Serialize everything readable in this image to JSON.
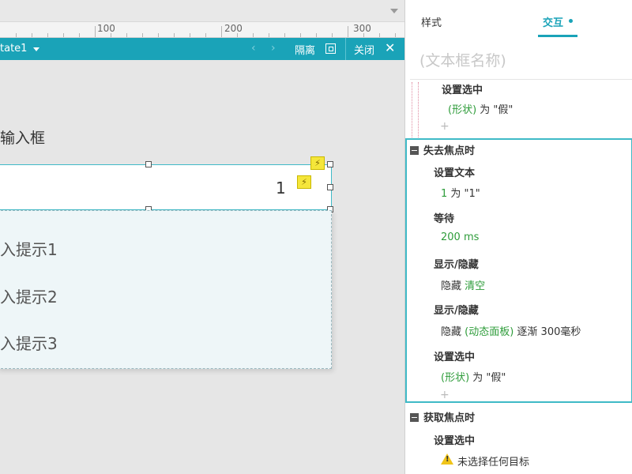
{
  "ruler": {
    "labels": [
      "100",
      "200",
      "300"
    ]
  },
  "state_bar": {
    "state_name": "tate1",
    "prev_arrow": "‹",
    "next_arrow": "›",
    "isolate_label": "隔离",
    "close_label": "关闭",
    "close_glyph": "✕",
    "color": "#1aa3b8"
  },
  "canvas": {
    "field_label": "输入框",
    "input_value": "1",
    "hints": [
      "入提示1",
      "入提示2",
      "入提示3"
    ],
    "bolt_glyph": "⚡"
  },
  "panel": {
    "tabs": {
      "style": "样式",
      "interaction": "交互"
    },
    "name_placeholder": "(文本框名称)",
    "top_action": {
      "title": "设置选中",
      "target": "(形状)",
      "rest": " 为 \"假\""
    },
    "plus": "+",
    "blur_event": {
      "title": "失去焦点时",
      "actions": [
        {
          "title": "设置文本",
          "target": "1",
          "rest": " 为 \"1\""
        },
        {
          "title": "等待",
          "target": "200 ms",
          "rest": ""
        },
        {
          "title": "显示/隐藏",
          "prefix": "隐藏 ",
          "target": "清空",
          "rest": ""
        },
        {
          "title": "显示/隐藏",
          "prefix": "隐藏 ",
          "target": "(动态面板)",
          "rest": " 逐渐 300毫秒"
        },
        {
          "title": "设置选中",
          "target": "(形状)",
          "rest": " 为 \"假\""
        }
      ]
    },
    "focus_event": {
      "title": "获取焦点时",
      "action_title": "设置选中",
      "warning": "未选择任何目标"
    }
  },
  "colors": {
    "accent": "#1aa3b8",
    "green": "#2e9c3a",
    "bolt": "#f5e63a"
  }
}
